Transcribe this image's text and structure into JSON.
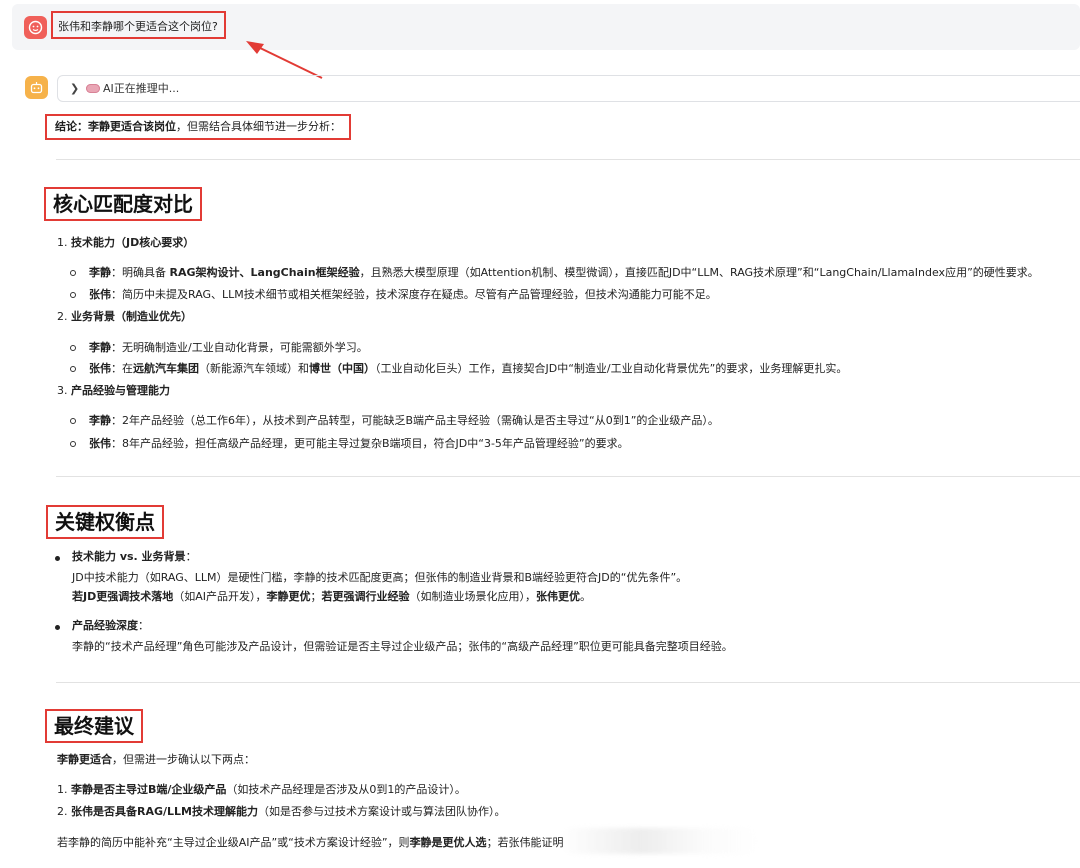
{
  "user": {
    "question": "张伟和李静哪个更适合这个岗位?"
  },
  "reasoning": {
    "label": "AI正在推理中..."
  },
  "conclusion": {
    "prefix": "结论：",
    "bold": "李静更适合该岗位",
    "rest": "，但需结合具体细节进一步分析："
  },
  "section1": {
    "title": "核心匹配度对比",
    "items": [
      {
        "number": "1.",
        "heading": "技术能力（JD核心要求）",
        "points": [
          {
            "name": "李静",
            "a": "：明确具备 ",
            "b": "RAG架构设计、LangChain框架经验",
            "c": "，且熟悉大模型原理（如Attention机制、模型微调），直接匹配JD中“LLM、RAG技术原理”和“LangChain/LlamaIndex应用”的硬性要求。"
          },
          {
            "name": "张伟",
            "a": "：简历中未提及RAG、LLM技术细节或相关框架经验，技术深度存在疑虑。尽管有产品管理经验，但技术沟通能力可能不足。"
          }
        ]
      },
      {
        "number": "2.",
        "heading": "业务背景（制造业优先）",
        "points": [
          {
            "name": "李静",
            "a": "：无明确制造业/工业自动化背景，可能需额外学习。"
          },
          {
            "name": "张伟",
            "a": "：在",
            "b": "远航汽车集团",
            "c": "（新能源汽车领域）和",
            "d": "博世（中国）",
            "e": "（工业自动化巨头）工作，直接契合JD中“制造业/工业自动化背景优先”的要求，业务理解更扎实。"
          }
        ]
      },
      {
        "number": "3.",
        "heading": "产品经验与管理能力",
        "points": [
          {
            "name": "李静",
            "a": "：2年产品经验（总工作6年），从技术到产品转型，可能缺乏B端产品主导经验（需确认是否主导过“从0到1”的企业级产品）。"
          },
          {
            "name": "张伟",
            "a": "：8年产品经验，担任高级产品经理，更可能主导过复杂B端项目，符合JD中“3-5年产品管理经验”的要求。"
          }
        ]
      }
    ]
  },
  "section2": {
    "title": "关键权衡点",
    "b1": {
      "heading": "技术能力 vs. 业务背景",
      "colon": "：",
      "line1": "JD中技术能力（如RAG、LLM）是硬性门槛，李静的技术匹配度更高；但张伟的制造业背景和B端经验更符合JD的“优先条件”。",
      "l2a": "若JD更强调技术落地",
      "l2b": "（如AI产品开发），",
      "l2c": "李静更优",
      "l2d": "；",
      "l2e": "若更强调行业经验",
      "l2f": "（如制造业场景化应用），",
      "l2g": "张伟更优",
      "l2h": "。"
    },
    "b2": {
      "heading": "产品经验深度",
      "colon": "：",
      "line1": "李静的“技术产品经理”角色可能涉及产品设计，但需验证是否主导过企业级产品；张伟的“高级产品经理”职位更可能具备完整项目经验。"
    }
  },
  "section3": {
    "title": "最终建议",
    "lead_bold": "李静更适合",
    "lead_rest": "，但需进一步确认以下两点：",
    "items": [
      {
        "number": "1.",
        "bold": "李静是否主导过B端/企业级产品",
        "rest": "（如技术产品经理是否涉及从0到1的产品设计）。"
      },
      {
        "number": "2.",
        "bold": "张伟是否具备RAG/LLM技术理解能力",
        "rest": "（如是否参与过技术方案设计或与算法团队协作）。"
      }
    ],
    "final_a": "若李静的简历中能补充“主导过企业级AI产品”或“技术方案设计经验”，则",
    "final_b": "李静是更优人选",
    "final_c": "；若张伟能证明"
  }
}
